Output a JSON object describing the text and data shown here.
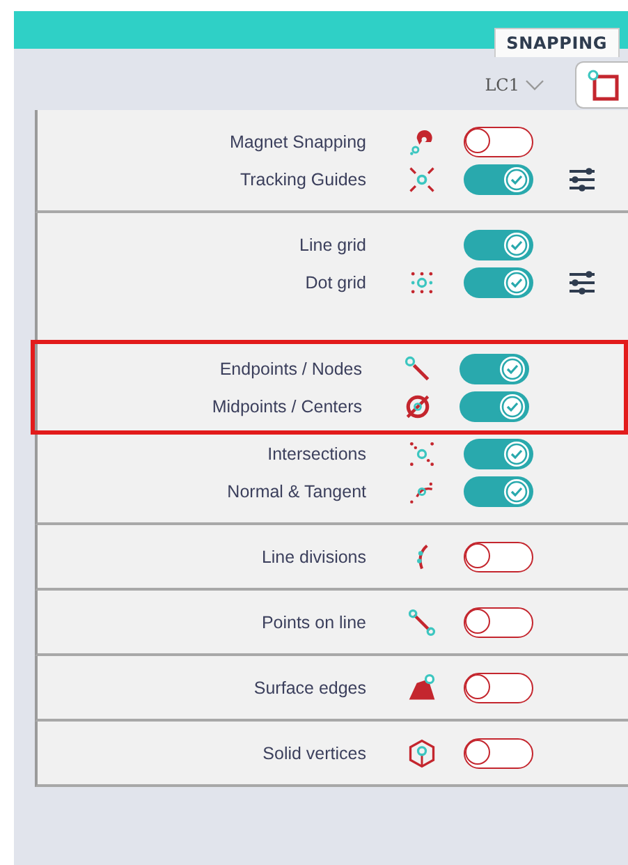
{
  "tab": {
    "label": "SNAPPING"
  },
  "load_case": {
    "value": "LC1"
  },
  "groups": [
    {
      "rows": [
        {
          "label": "Magnet Snapping",
          "on": false,
          "highlighted": false,
          "settings_button": false
        },
        {
          "label": "Tracking Guides",
          "on": true,
          "highlighted": false,
          "settings_button": true
        }
      ]
    },
    {
      "rows": [
        {
          "label": "Line grid",
          "on": true,
          "highlighted": false,
          "settings_button": false
        },
        {
          "label": "Dot grid",
          "on": true,
          "highlighted": false,
          "settings_button": true
        },
        {
          "label": "Endpoints / Nodes",
          "on": true,
          "highlighted": true,
          "settings_button": false
        },
        {
          "label": "Midpoints / Centers",
          "on": true,
          "highlighted": true,
          "settings_button": false
        },
        {
          "label": "Intersections",
          "on": true,
          "highlighted": false,
          "settings_button": false
        },
        {
          "label": "Normal & Tangent",
          "on": true,
          "highlighted": false,
          "settings_button": false
        }
      ]
    },
    {
      "rows": [
        {
          "label": "Line divisions",
          "on": false,
          "highlighted": false,
          "settings_button": false
        }
      ]
    },
    {
      "rows": [
        {
          "label": "Points on line",
          "on": false,
          "highlighted": false,
          "settings_button": false
        }
      ]
    },
    {
      "rows": [
        {
          "label": "Surface edges",
          "on": false,
          "highlighted": false,
          "settings_button": false
        }
      ]
    },
    {
      "rows": [
        {
          "label": "Solid vertices",
          "on": false,
          "highlighted": false,
          "settings_button": false
        }
      ]
    }
  ]
}
